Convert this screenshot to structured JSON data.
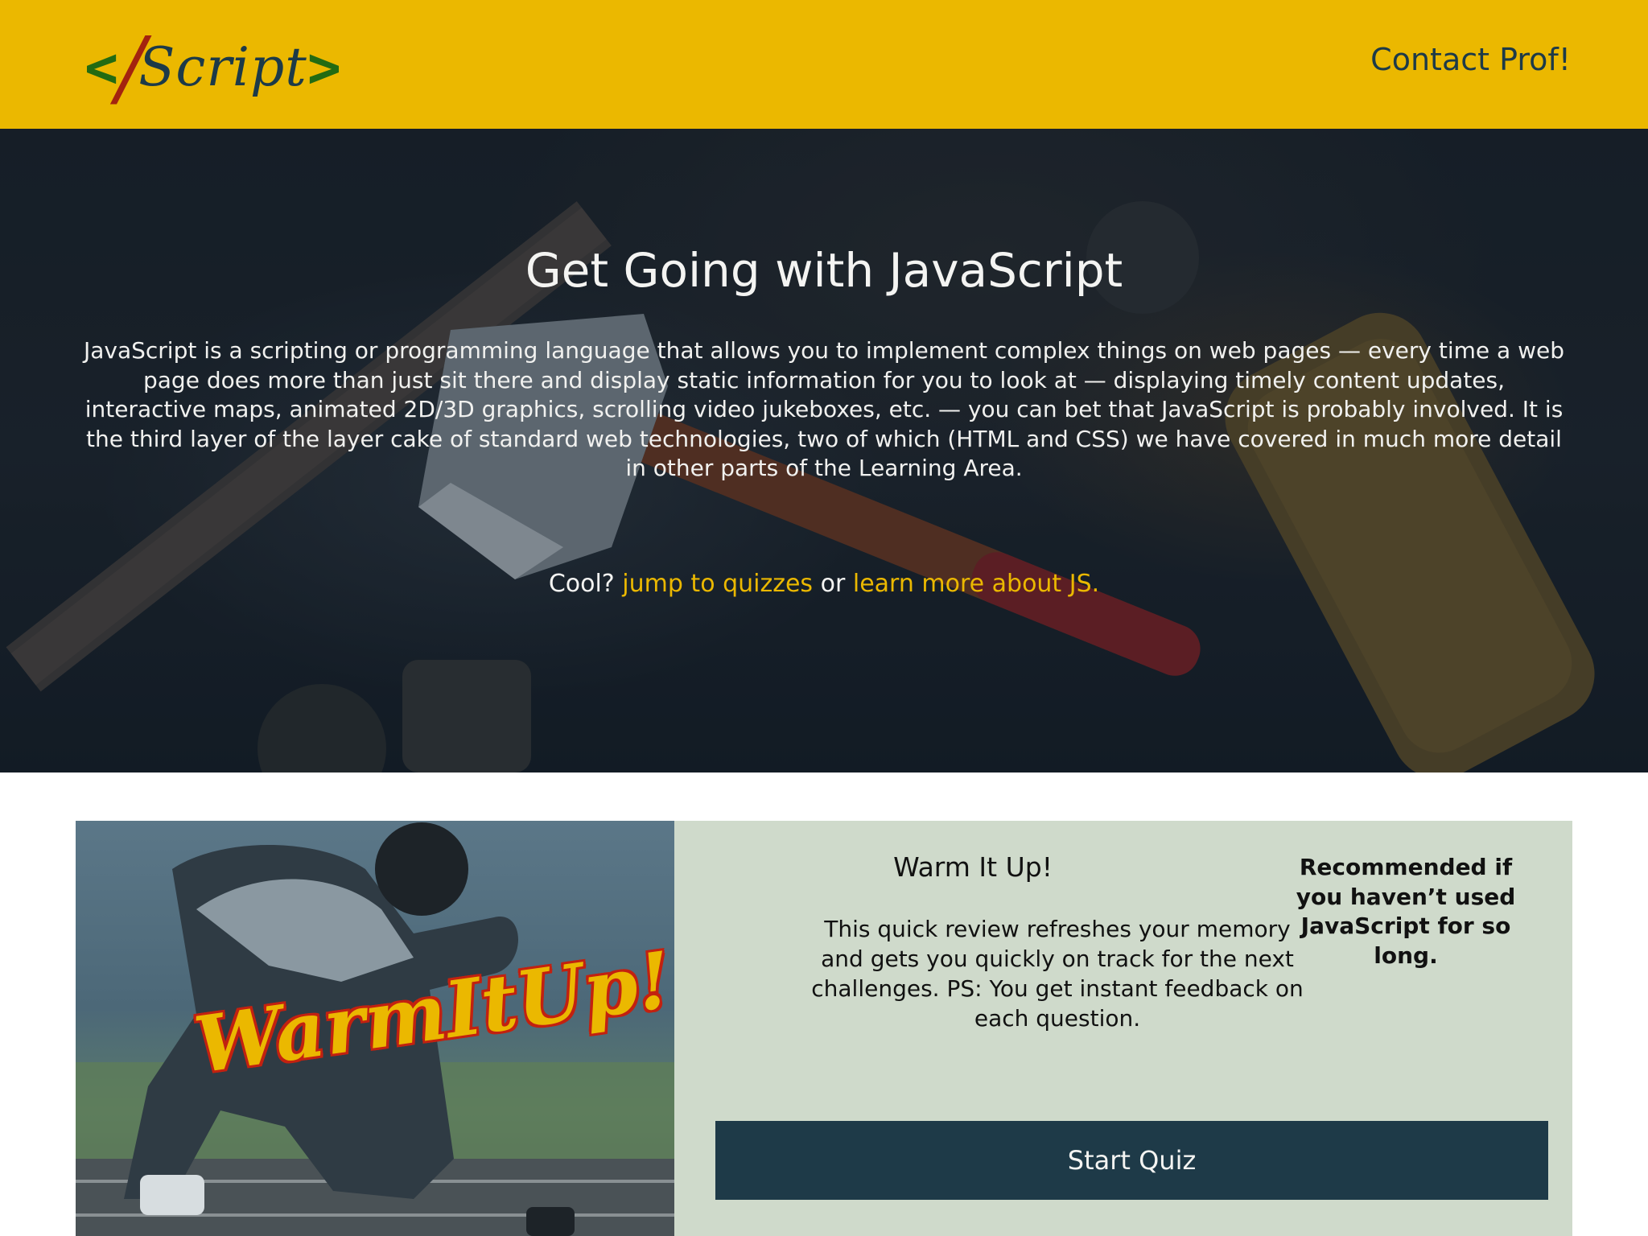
{
  "header": {
    "logo": {
      "open": "</",
      "word": "Script",
      "close": ">"
    },
    "contact_label": "Contact Prof!"
  },
  "hero": {
    "title": "Get Going with JavaScript",
    "body": "JavaScript is a scripting or programming language that allows you to implement complex things on web pages — every time a web page does more than just sit there and display static information for you to look at — displaying timely content updates, interactive maps, animated 2D/3D graphics, scrolling video jukeboxes, etc. — you can bet that JavaScript is probably involved. It is the third layer of the layer cake of standard web technologies, two of which (HTML and CSS) we have covered in much more detail in other parts of the Learning Area.",
    "cta_prefix": "Cool?",
    "cta_link1": "jump to quizzes",
    "cta_mid": "or",
    "cta_link2": "learn more about JS."
  },
  "quiz_card": {
    "image_text": "WarmItUp!",
    "title": "Warm It Up!",
    "description": "This quick review refreshes your memory and gets you quickly on track for the next challenges. PS: You get instant feedback on each question.",
    "note": "Recommended if you haven’t used JavaScript for so long.",
    "button_label": "Start Quiz"
  },
  "colors": {
    "brand_yellow": "#ebb800",
    "dark_teal": "#1e3a48",
    "card_bg": "#cfdacb",
    "logo_green": "#236b12",
    "logo_red": "#a3230f"
  }
}
